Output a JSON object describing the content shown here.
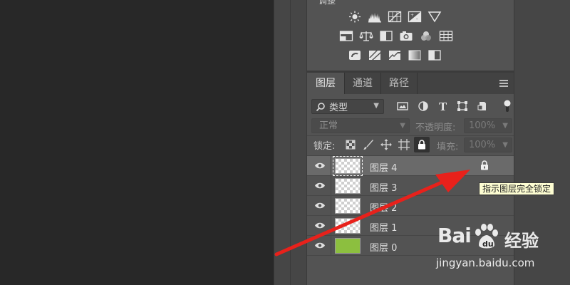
{
  "adjustments": {
    "title": "调整"
  },
  "tabs": [
    {
      "label": "图层",
      "active": true
    },
    {
      "label": "通道",
      "active": false
    },
    {
      "label": "路径",
      "active": false
    }
  ],
  "filter": {
    "kind_label": "类型",
    "icons": [
      "image-filter-icon",
      "adjustment-filter-icon",
      "type-filter-icon",
      "shape-filter-icon",
      "smart-object-filter-icon"
    ]
  },
  "blend": {
    "mode": "正常",
    "opacity_label": "不透明度:",
    "opacity_value": "100%"
  },
  "lock": {
    "label": "锁定:",
    "fill_label": "填充:",
    "fill_value": "100%"
  },
  "layers": [
    {
      "name": "图层 4",
      "selected": true,
      "locked": true,
      "thumb": "transparent"
    },
    {
      "name": "图层 3",
      "selected": false,
      "locked": false,
      "thumb": "transparent"
    },
    {
      "name": "图层 2",
      "selected": false,
      "locked": false,
      "thumb": "transparent"
    },
    {
      "name": "图层 1",
      "selected": false,
      "locked": false,
      "thumb": "transparent"
    },
    {
      "name": "图层 0",
      "selected": false,
      "locked": false,
      "thumb": "green"
    }
  ],
  "tooltip": {
    "text": "指示图层完全锁定"
  },
  "watermark": {
    "brand": "Bai",
    "brand_cn": "经验",
    "url": "jingyan.baidu.com"
  },
  "colors": {
    "panel": "#535353",
    "arrow": "#e8211b",
    "thumb_green": "#8cbf3f",
    "tooltip_bg": "#fdfdd2"
  }
}
